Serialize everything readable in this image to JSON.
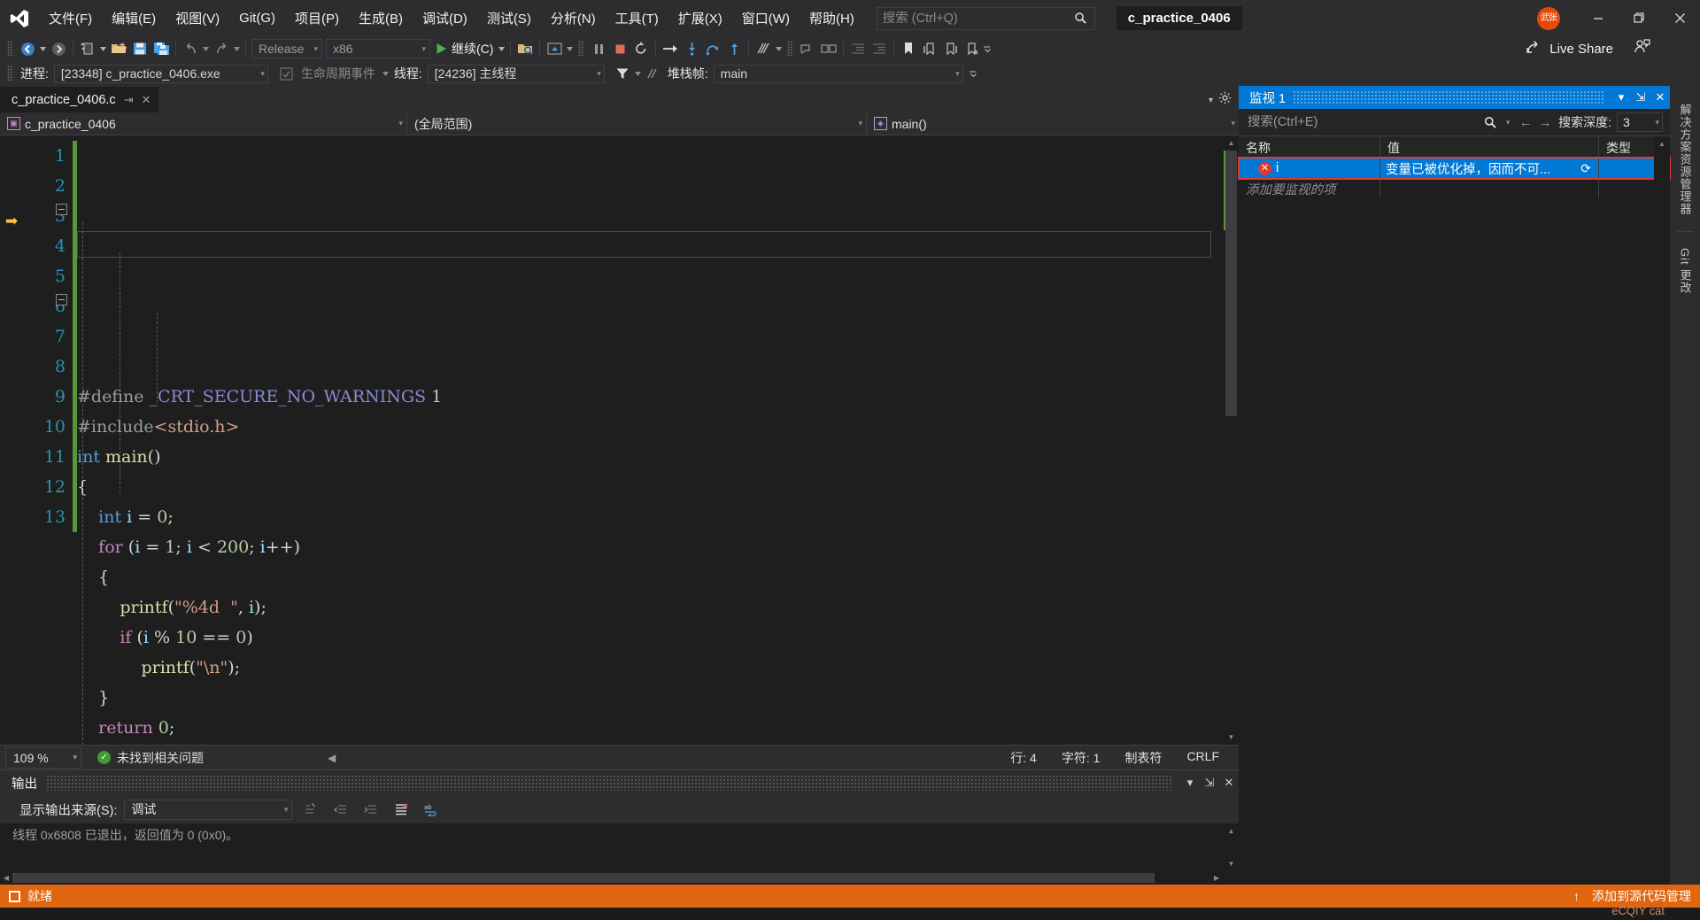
{
  "window": {
    "project_chip": "c_practice_0406",
    "avatar_initials": "武张",
    "live_share": "Live Share",
    "minimize": "—",
    "maximize": "❐",
    "close": "✕"
  },
  "menu": {
    "items": [
      {
        "label": "文件(F)"
      },
      {
        "label": "编辑(E)"
      },
      {
        "label": "视图(V)"
      },
      {
        "label": "Git(G)"
      },
      {
        "label": "项目(P)"
      },
      {
        "label": "生成(B)"
      },
      {
        "label": "调试(D)"
      },
      {
        "label": "测试(S)"
      },
      {
        "label": "分析(N)"
      },
      {
        "label": "工具(T)"
      },
      {
        "label": "扩展(X)"
      },
      {
        "label": "窗口(W)"
      },
      {
        "label": "帮助(H)"
      }
    ]
  },
  "search": {
    "placeholder": "搜索 (Ctrl+Q)",
    "value": ""
  },
  "toolbar": {
    "configuration": "Release",
    "platform": "x86",
    "run_label": "继续(C)"
  },
  "debugbar": {
    "process_label": "进程:",
    "process_value": "[23348] c_practice_0406.exe",
    "lifecycle_label": "生命周期事件",
    "thread_label": "线程:",
    "thread_value": "[24236] 主线程",
    "stackframe_label": "堆栈帧:",
    "stackframe_value": "main"
  },
  "editor": {
    "tab_title": "c_practice_0406.c",
    "nav_project": "c_practice_0406",
    "nav_scope": "(全局范围)",
    "nav_member": "main()",
    "lines": [
      {
        "n": "1",
        "html": "<span class=\"pp\">#define</span> <span class=\"macro\">_CRT_SECURE_NO_WARNINGS</span> <span class=\"num\">1</span>"
      },
      {
        "n": "2",
        "html": "<span class=\"pp\">#include</span><span class=\"inc\">&lt;stdio.h&gt;</span>"
      },
      {
        "n": "3",
        "html": "<span class=\"kw\">int</span> <span class=\"fn\">main</span><span class=\"pun\">()</span>"
      },
      {
        "n": "4",
        "html": "<span class=\"pun\">{</span>"
      },
      {
        "n": "5",
        "html": "    <span class=\"kw\">int</span> <span class=\"id\">i</span> <span class=\"pun\">=</span> <span class=\"num\">0</span><span class=\"pun\">;</span>"
      },
      {
        "n": "6",
        "html": "    <span class=\"kwp\">for</span> <span class=\"pun\">(</span><span class=\"id\">i</span> <span class=\"pun\">=</span> <span class=\"num\">1</span><span class=\"pun\">;</span> <span class=\"id\">i</span> <span class=\"pun\">&lt;</span> <span class=\"num\">200</span><span class=\"pun\">;</span> <span class=\"id\">i</span><span class=\"pun\">++)</span>"
      },
      {
        "n": "7",
        "html": "    <span class=\"pun\">{</span>"
      },
      {
        "n": "8",
        "html": "        <span class=\"fn\">printf</span><span class=\"pun\">(</span><span class=\"str\">\"%4d  \"</span><span class=\"pun\">,</span> <span class=\"id\">i</span><span class=\"pun\">);</span>"
      },
      {
        "n": "9",
        "html": "        <span class=\"kwp\">if</span> <span class=\"pun\">(</span><span class=\"id\">i</span> <span class=\"pun\">%</span> <span class=\"num\">10</span> <span class=\"pun\">==</span> <span class=\"num\">0</span><span class=\"pun\">)</span>"
      },
      {
        "n": "10",
        "html": "            <span class=\"fn\">printf</span><span class=\"pun\">(</span><span class=\"str\">\"\\n\"</span><span class=\"pun\">);</span>"
      },
      {
        "n": "11",
        "html": "    <span class=\"pun\">}</span>"
      },
      {
        "n": "12",
        "html": "    <span class=\"kwp\">return</span> <span class=\"num\">0</span><span class=\"pun\">;</span>"
      },
      {
        "n": "13",
        "html": "<span class=\"pun\">}</span>"
      }
    ]
  },
  "editor_status": {
    "zoom": "109 %",
    "problems": "未找到相关问题",
    "line": "行: 4",
    "column": "字符: 1",
    "tabs": "制表符",
    "eol": "CRLF"
  },
  "output": {
    "title": "输出",
    "source_label": "显示输出来源(S):",
    "source_value": "调试",
    "lines": [
      "线程 0x6808 已退出，返回值为 0 (0x0)。"
    ]
  },
  "watch": {
    "title": "监视 1",
    "search_placeholder": "搜索(Ctrl+E)",
    "depth_label": "搜索深度:",
    "depth_value": "3",
    "columns": [
      "名称",
      "值",
      "类型"
    ],
    "rows": [
      {
        "name": "i",
        "value": "变量已被优化掉，因而不可...",
        "type": "",
        "error": true,
        "selected": true
      }
    ],
    "add_item_placeholder": "添加要监视的项"
  },
  "right_tabs": {
    "items": [
      "解决方案资源管理器",
      "Git 更改"
    ]
  },
  "statusbar": {
    "ready": "就绪",
    "source_control": "添加到源代码管理",
    "watermark": "eCQIY cat"
  }
}
